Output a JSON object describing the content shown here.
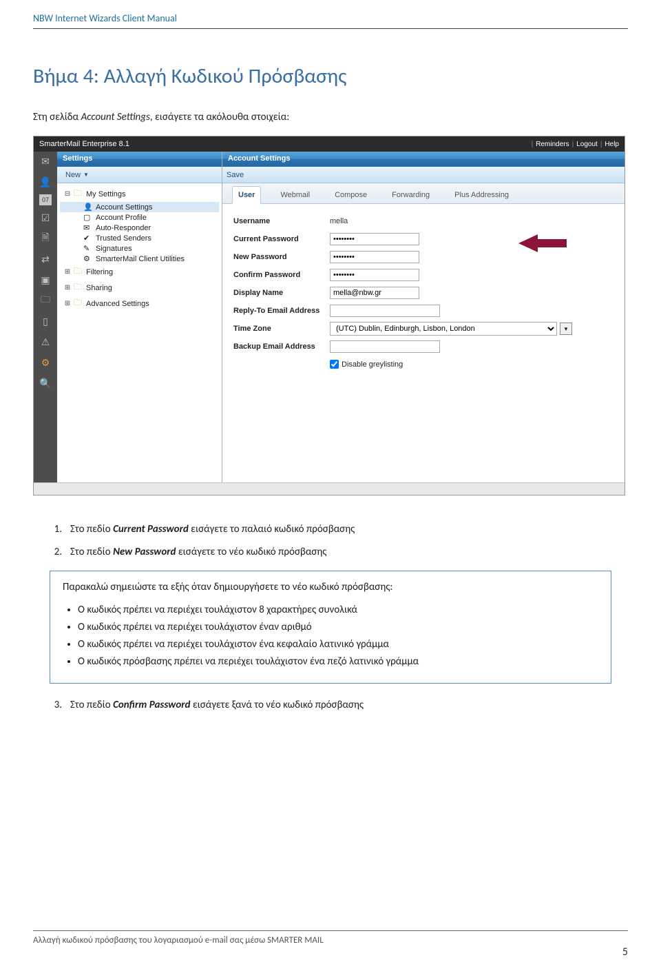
{
  "doc": {
    "header": "NBW Internet Wizards Client Manual",
    "step_title": "Βήμα 4: Αλλαγή Κωδικού Πρόσβασης",
    "intro_pre": "Στη σελίδα ",
    "intro_em": "Account Settings",
    "intro_post": ", εισάγετε τα ακόλουθα στοιχεία:",
    "footer_text": "Αλλαγή κωδικού πρόσβασης του λογαριασμού e-mail σας μέσω SMARTER MAIL",
    "page_number": "5"
  },
  "screenshot": {
    "app_title": "SmarterMail Enterprise 8.1",
    "header_links": {
      "reminders": "Reminders",
      "logout": "Logout",
      "help": "Help"
    },
    "iconstrip": {
      "mail": "mail-icon",
      "contact": "contact-icon",
      "cal_label": "07",
      "tasks": "tasks-icon",
      "notes": "notes-icon",
      "sync": "sync-icon",
      "rss": "rss-icon",
      "files": "files-icon",
      "reports": "reports-icon",
      "alerts": "alerts-icon",
      "gear": "gear-icon",
      "search": "search-icon"
    },
    "sidebar": {
      "title": "Settings",
      "new_label": "New",
      "tree": {
        "my_settings": "My Settings",
        "account_settings": "Account Settings",
        "account_profile": "Account Profile",
        "auto_responder": "Auto-Responder",
        "trusted_senders": "Trusted Senders",
        "signatures": "Signatures",
        "client_utilities": "SmarterMail Client Utilities",
        "filtering": "Filtering",
        "sharing": "Sharing",
        "advanced": "Advanced Settings"
      }
    },
    "main": {
      "panel_title": "Account Settings",
      "save_label": "Save",
      "tabs": {
        "user": "User",
        "webmail": "Webmail",
        "compose": "Compose",
        "forwarding": "Forwarding",
        "plus_addressing": "Plus Addressing"
      },
      "form": {
        "username_label": "Username",
        "username_value": "mella",
        "current_pw_label": "Current Password",
        "current_pw_value": "••••••••",
        "new_pw_label": "New Password",
        "new_pw_value": "••••••••",
        "confirm_pw_label": "Confirm Password",
        "confirm_pw_value": "••••••••",
        "display_name_label": "Display Name",
        "display_name_value": "mella@nbw.gr",
        "replyto_label": "Reply-To Email Address",
        "replyto_value": "",
        "timezone_label": "Time Zone",
        "timezone_value": "(UTC) Dublin, Edinburgh, Lisbon, London",
        "backup_label": "Backup Email Address",
        "backup_value": "",
        "greylisting_label": "Disable greylisting"
      }
    }
  },
  "instructions": {
    "item1_pre": "Στο πεδίο ",
    "item1_bold": "Current Password",
    "item1_post": " εισάγετε το παλαιό κωδικό πρόσβασης",
    "item2_pre": "Στο πεδίο ",
    "item2_bold": "New Password",
    "item2_post": " εισάγετε το νέο κωδικό πρόσβασης",
    "note_intro": "Παρακαλώ σημειώστε τα εξής όταν δημιουργήσετε το νέο κωδικό πρόσβασης:",
    "bullets": [
      "Ο κωδικός πρέπει να περιέχει τουλάχιστον 8 χαρακτήρες συνολικά",
      "Ο κωδικός πρέπει να περιέχει τουλάχιστον έναν αριθμό",
      "Ο κωδικός πρέπει να περιέχει τουλάχιστον ένα κεφαλαίο λατινικό γράμμα",
      "Ο κωδικός πρόσβασης πρέπει να περιέχει τουλάχιστον ένα πεζό λατινικό γράμμα"
    ],
    "item3_pre": "Στο πεδίο ",
    "item3_bold": "Confirm Password",
    "item3_post": " εισάγετε ξανά το νέο κωδικό πρόσβασης"
  }
}
